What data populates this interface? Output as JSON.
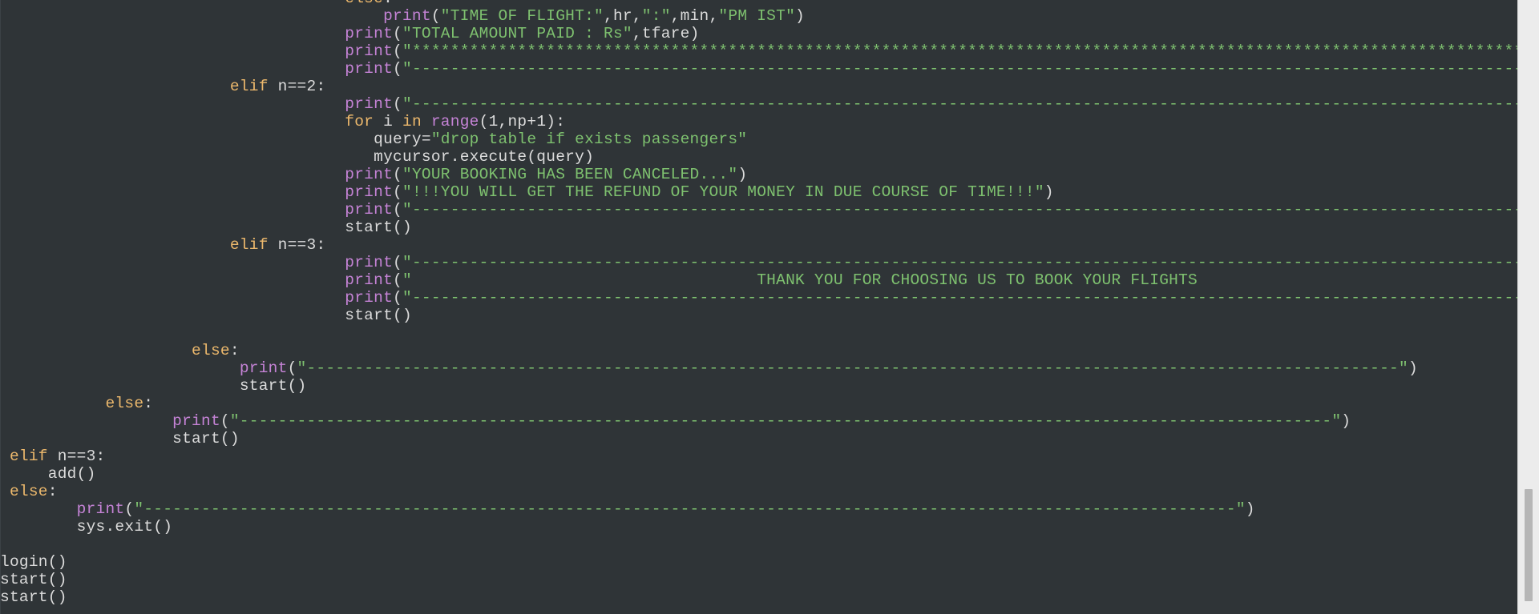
{
  "editor": {
    "language": "python",
    "lines": [
      [
        [
          "kw",
          "else"
        ],
        [
          "punct",
          ":"
        ]
      ],
      [
        [
          "fn",
          "print"
        ],
        [
          "punct",
          "("
        ],
        [
          "str",
          "\"TIME OF FLIGHT:\""
        ],
        [
          "punct",
          ","
        ],
        [
          "ident",
          "hr"
        ],
        [
          "punct",
          ","
        ],
        [
          "str",
          "\":\""
        ],
        [
          "punct",
          ","
        ],
        [
          "ident",
          "min"
        ],
        [
          "punct",
          ","
        ],
        [
          "str",
          "\"PM IST\""
        ],
        [
          "punct",
          ")"
        ]
      ],
      [
        [
          "fn",
          "print"
        ],
        [
          "punct",
          "("
        ],
        [
          "str",
          "\"TOTAL AMOUNT PAID : Rs\""
        ],
        [
          "punct",
          ","
        ],
        [
          "ident",
          "tfare"
        ],
        [
          "punct",
          ")"
        ]
      ],
      [
        [
          "fn",
          "print"
        ],
        [
          "punct",
          "("
        ],
        [
          "str",
          "\"*********************************************************************************************************************"
        ]
      ],
      [
        [
          "fn",
          "print"
        ],
        [
          "punct",
          "("
        ],
        [
          "str",
          "\"---------------------------------------------------------------------------------------------------------------------"
        ]
      ],
      [
        [
          "kw",
          "elif"
        ],
        [
          "ident",
          " n==2"
        ],
        [
          "punct",
          ":"
        ]
      ],
      [
        [
          "fn",
          "print"
        ],
        [
          "punct",
          "("
        ],
        [
          "str",
          "\"---------------------------------------------------------------------------------------------------------------------"
        ]
      ],
      [
        [
          "kw",
          "for"
        ],
        [
          "ident",
          " i "
        ],
        [
          "kw",
          "in"
        ],
        [
          "ident",
          " "
        ],
        [
          "fn",
          "range"
        ],
        [
          "punct",
          "("
        ],
        [
          "ident",
          "1,np+1"
        ],
        [
          "punct",
          "):"
        ]
      ],
      [
        [
          "ident",
          "query="
        ],
        [
          "str",
          "\"drop table if exists passengers\""
        ]
      ],
      [
        [
          "ident",
          "mycursor.execute(query)"
        ]
      ],
      [
        [
          "fn",
          "print"
        ],
        [
          "punct",
          "("
        ],
        [
          "str",
          "\"YOUR BOOKING HAS BEEN CANCELED...\""
        ],
        [
          "punct",
          ")"
        ]
      ],
      [
        [
          "fn",
          "print"
        ],
        [
          "punct",
          "("
        ],
        [
          "str",
          "\"!!!YOU WILL GET THE REFUND OF YOUR MONEY IN DUE COURSE OF TIME!!!\""
        ],
        [
          "punct",
          ")"
        ]
      ],
      [
        [
          "fn",
          "print"
        ],
        [
          "punct",
          "("
        ],
        [
          "str",
          "\"---------------------------------------------------------------------------------------------------------------------"
        ]
      ],
      [
        [
          "ident",
          "start()"
        ]
      ],
      [
        [
          "kw",
          "elif"
        ],
        [
          "ident",
          " n==3"
        ],
        [
          "punct",
          ":"
        ]
      ],
      [
        [
          "fn",
          "print"
        ],
        [
          "punct",
          "("
        ],
        [
          "str",
          "\"---------------------------------------------------------------------------------------------------------------------"
        ]
      ],
      [
        [
          "fn",
          "print"
        ],
        [
          "punct",
          "("
        ],
        [
          "str",
          "\"                                    THANK YOU FOR CHOOSING US TO BOOK YOUR FLIGHTS"
        ]
      ],
      [
        [
          "fn",
          "print"
        ],
        [
          "punct",
          "("
        ],
        [
          "str",
          "\"---------------------------------------------------------------------------------------------------------------------"
        ]
      ],
      [
        [
          "ident",
          "start()"
        ]
      ],
      [],
      [
        [
          "kw",
          "else"
        ],
        [
          "punct",
          ":"
        ]
      ],
      [
        [
          "fn",
          "print"
        ],
        [
          "punct",
          "("
        ],
        [
          "str",
          "\"------------------------------------------------------------------------------------------------------------------\""
        ],
        [
          "punct",
          ")"
        ]
      ],
      [
        [
          "ident",
          "start()"
        ]
      ],
      [
        [
          "kw",
          "else"
        ],
        [
          "punct",
          ":"
        ]
      ],
      [
        [
          "fn",
          "print"
        ],
        [
          "punct",
          "("
        ],
        [
          "str",
          "\"------------------------------------------------------------------------------------------------------------------\""
        ],
        [
          "punct",
          ")"
        ]
      ],
      [
        [
          "ident",
          "start()"
        ]
      ],
      [
        [
          "kw",
          "elif"
        ],
        [
          "ident",
          " n==3"
        ],
        [
          "punct",
          ":"
        ]
      ],
      [
        [
          "ident",
          "add()"
        ]
      ],
      [
        [
          "kw",
          "else"
        ],
        [
          "punct",
          ":"
        ]
      ],
      [
        [
          "fn",
          "print"
        ],
        [
          "punct",
          "("
        ],
        [
          "str",
          "\"------------------------------------------------------------------------------------------------------------------\""
        ],
        [
          "punct",
          ")"
        ]
      ],
      [
        [
          "ident",
          "sys.exit()"
        ]
      ],
      [],
      [
        [
          "ident",
          "login()"
        ]
      ],
      [
        [
          "ident",
          "start()"
        ]
      ],
      [
        [
          "ident",
          "start()"
        ]
      ]
    ]
  },
  "colors": {
    "background": "#2f3437",
    "keyword": "#ecb86c",
    "builtin": "#c583d6",
    "string": "#7ec16f",
    "text": "#dcdcdc",
    "scrollbar_track": "#ececec",
    "scrollbar_thumb": "#b6b6b6"
  },
  "scrollbar": {
    "position_fraction": 0.98
  }
}
